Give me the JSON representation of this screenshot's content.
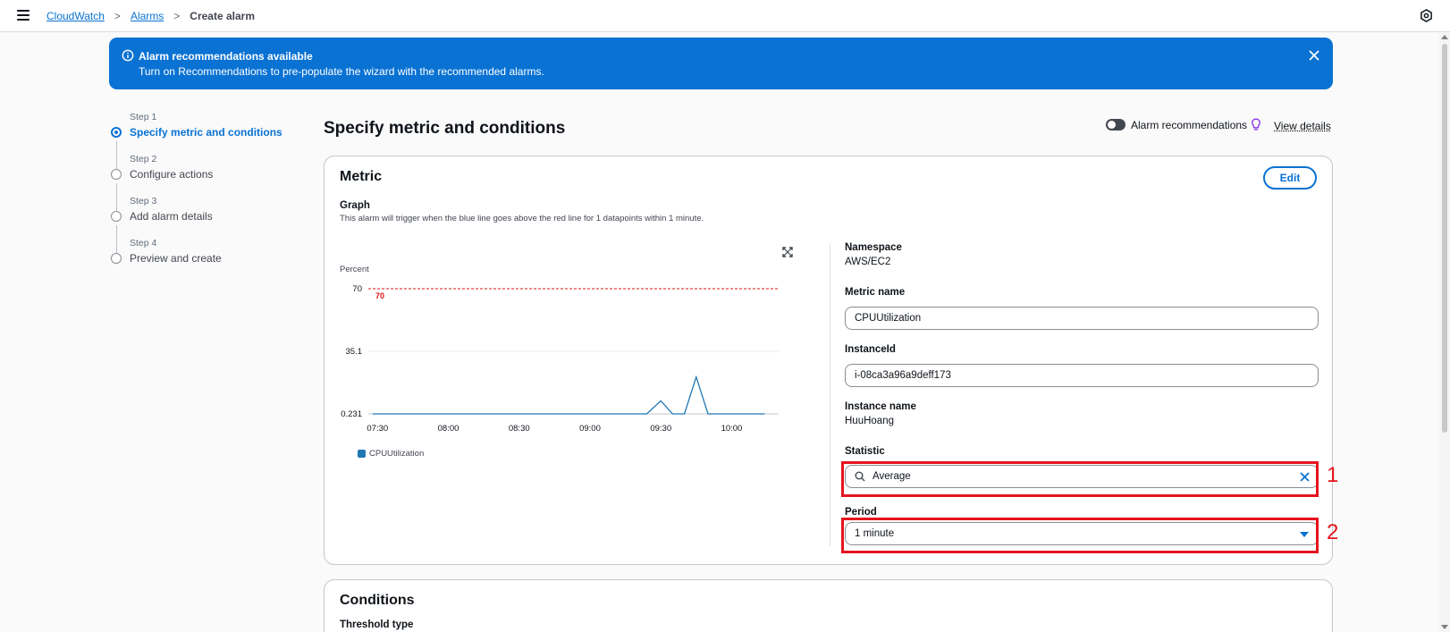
{
  "topbar": {
    "menu_icon": "hamburger-menu-icon",
    "breadcrumbs": [
      "CloudWatch",
      "Alarms",
      "Create alarm"
    ],
    "right_icon": "settings-hexagon-icon"
  },
  "flash": {
    "title": "Alarm recommendations available",
    "body": "Turn on Recommendations to pre-populate the wizard with the recommended alarms.",
    "info_icon": "info-icon",
    "close_icon": "close-icon",
    "color": "#0972d3"
  },
  "steps": [
    {
      "num": "Step 1",
      "title": "Specify metric and conditions",
      "active": true
    },
    {
      "num": "Step 2",
      "title": "Configure actions",
      "active": false
    },
    {
      "num": "Step 3",
      "title": "Add alarm details",
      "active": false
    },
    {
      "num": "Step 4",
      "title": "Preview and create",
      "active": false
    }
  ],
  "header": {
    "title": "Specify metric and conditions",
    "recommendations_label": "Alarm recommendations",
    "recommendations_on": false,
    "view_details": "View details"
  },
  "metric": {
    "title": "Metric",
    "edit_label": "Edit",
    "graph_label": "Graph",
    "graph_desc": "This alarm will trigger when the blue line goes above the red line for 1 datapoints within 1 minute.",
    "namespace_label": "Namespace",
    "namespace_value": "AWS/EC2",
    "metric_name_label": "Metric name",
    "metric_name_value": "CPUUtilization",
    "instance_id_label": "InstanceId",
    "instance_id_value": "i-08ca3a96a9deff173",
    "instance_name_label": "Instance name",
    "instance_name_value": "HuuHoang",
    "statistic_label": "Statistic",
    "statistic_value": "Average",
    "period_label": "Period",
    "period_value": "1 minute"
  },
  "annotations": [
    "1",
    "2"
  ],
  "conditions": {
    "title": "Conditions",
    "threshold_type_label": "Threshold type"
  },
  "chart_data": {
    "type": "line",
    "ylabel": "Percent",
    "yticks": [
      "70",
      "35.1",
      "0.231"
    ],
    "ylim": [
      0.231,
      70
    ],
    "xticks": [
      "07:30",
      "08:00",
      "08:30",
      "09:00",
      "09:30",
      "10:00"
    ],
    "threshold": {
      "value": 70,
      "label": "70",
      "color": "#d91515"
    },
    "series": [
      {
        "name": "CPUUtilization",
        "color": "#1f77b4",
        "x_minutes_from_0730": [
          0,
          110,
          116,
          122,
          127,
          132,
          137,
          142,
          147,
          152,
          166
        ],
        "values": [
          0.231,
          0.231,
          0.231,
          7.5,
          0.231,
          0.231,
          20.8,
          0.231,
          0.231,
          0.231,
          0.231
        ]
      }
    ]
  }
}
